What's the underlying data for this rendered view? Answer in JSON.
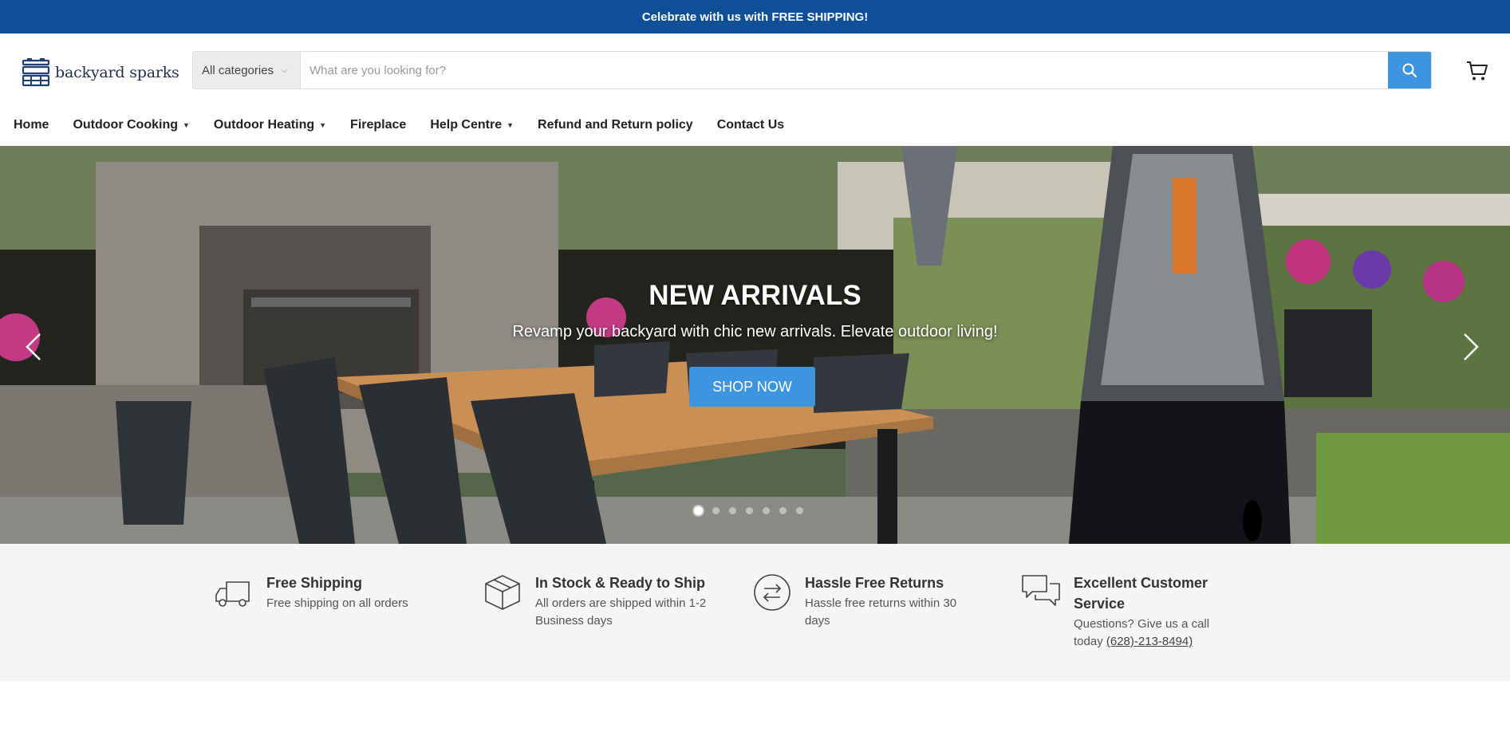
{
  "announcement": "Celebrate with us with FREE SHIPPING!",
  "logo": {
    "text": "backyard sparks"
  },
  "search": {
    "category": "All categories",
    "placeholder": "What are you looking for?"
  },
  "nav": [
    {
      "label": "Home",
      "dropdown": false
    },
    {
      "label": "Outdoor Cooking",
      "dropdown": true
    },
    {
      "label": "Outdoor Heating",
      "dropdown": true
    },
    {
      "label": "Fireplace",
      "dropdown": false
    },
    {
      "label": "Help Centre",
      "dropdown": true
    },
    {
      "label": "Refund and Return policy",
      "dropdown": false
    },
    {
      "label": "Contact Us",
      "dropdown": false
    }
  ],
  "hero": {
    "title": "NEW ARRIVALS",
    "subtitle": "Revamp your backyard with chic new arrivals. Elevate outdoor living!",
    "button": "SHOP NOW",
    "slides": 7,
    "active_slide": 1
  },
  "features": [
    {
      "icon": "truck-icon",
      "title": "Free Shipping",
      "desc": "Free shipping on all orders"
    },
    {
      "icon": "box-icon",
      "title": "In Stock & Ready to Ship",
      "desc": "All orders are shipped within 1-2 Business days"
    },
    {
      "icon": "returns-icon",
      "title": "Hassle Free Returns",
      "desc": "Hassle free returns within 30 days"
    },
    {
      "icon": "chat-icon",
      "title": "Excellent Customer Service",
      "desc": "Questions? Give us a call today",
      "phone": "(628)-213-8494)"
    }
  ],
  "colors": {
    "announcement_bg": "#0e4f96",
    "accent": "#3c95de",
    "features_bg": "#f5f5f5"
  }
}
